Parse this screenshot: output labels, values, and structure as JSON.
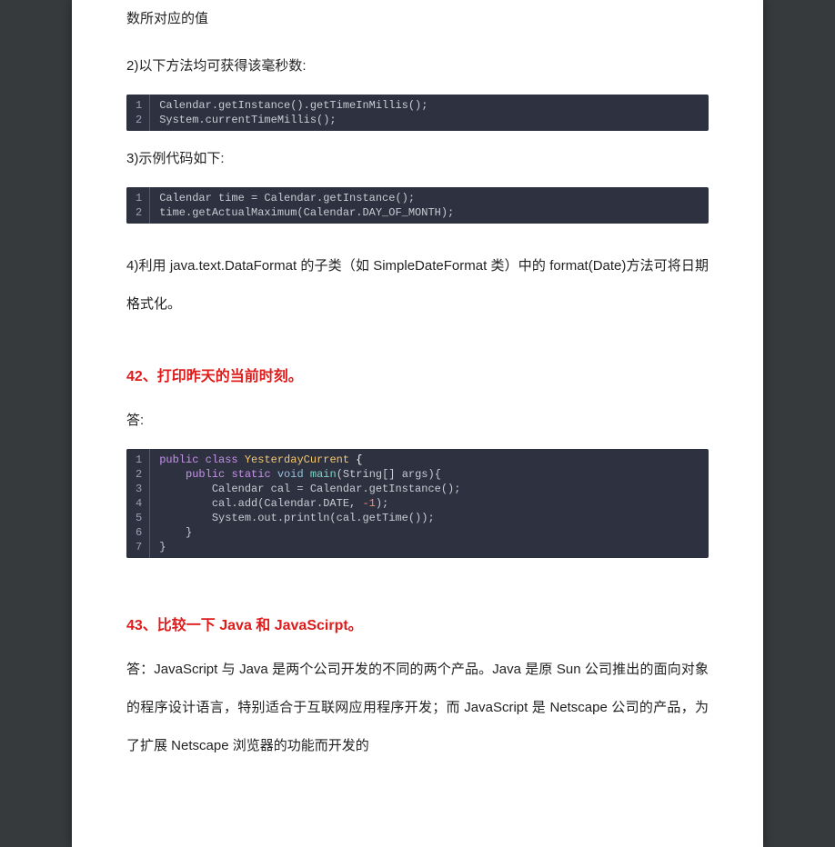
{
  "para_partial_top": "数所对应的值",
  "para_2_intro": "2)以下方法均可获得该毫秒数:",
  "code1": {
    "line1": "Calendar.getInstance().getTimeInMillis();",
    "line2": "System.currentTimeMillis();",
    "n1": "1",
    "n2": "2"
  },
  "para_3_intro": "3)示例代码如下:",
  "code2": {
    "line1": "Calendar time = Calendar.getInstance();",
    "line2": "time.getActualMaximum(Calendar.DAY_OF_MONTH);",
    "n1": "1",
    "n2": "2"
  },
  "para_4": "4)利用 java.text.DataFormat  的子类（如 SimpleDateFormat 类）中的 format(Date)方法可将日期格式化。",
  "heading_42": "42、打印昨天的当前时刻。",
  "answer42_label": "答:",
  "code3": {
    "n1": "1",
    "n2": "2",
    "n3": "3",
    "n4": "4",
    "n5": "5",
    "n6": "6",
    "n7": "7",
    "kw_public1": "public",
    "kw_class": "class",
    "cls_name": "YesterdayCurrent",
    "brace_open": " {",
    "kw_public2": "public",
    "kw_static": "static",
    "kw_void": "void",
    "fn_main": "main",
    "sig_main": "(String[] args){",
    "l3": "        Calendar cal = Calendar.getInstance();",
    "l4_a": "        cal.add(Calendar.DATE, ",
    "l4_num": "-1",
    "l4_b": ");",
    "l5": "        System.out.println(cal.getTime());",
    "l6": "    }",
    "l7": "}"
  },
  "heading_43": "43、比较一下 Java  和 JavaScirpt。",
  "answer43": "答：JavaScript  与 Java 是两个公司开发的不同的两个产品。Java  是原 Sun 公司推出的面向对象的程序设计语言，特别适合于互联网应用程序开发；而 JavaScript 是 Netscape 公司的产品，为了扩展 Netscape 浏览器的功能而开发的"
}
